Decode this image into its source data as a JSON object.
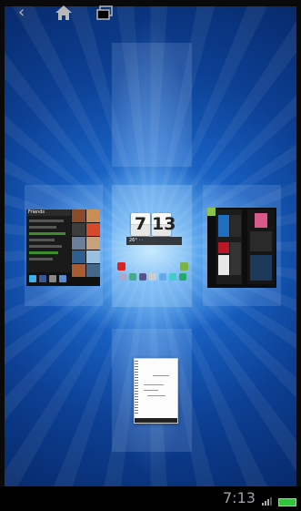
{
  "clock_widget": {
    "hour": "7",
    "minute": "13",
    "weather": "26° · ·"
  },
  "left_card": {
    "header": "Friends"
  },
  "status_bar": {
    "time": "7:13"
  },
  "nav": {
    "back_label": "‹"
  },
  "colors": {
    "accent": "#1e74d6",
    "battery": "#36c23d"
  }
}
